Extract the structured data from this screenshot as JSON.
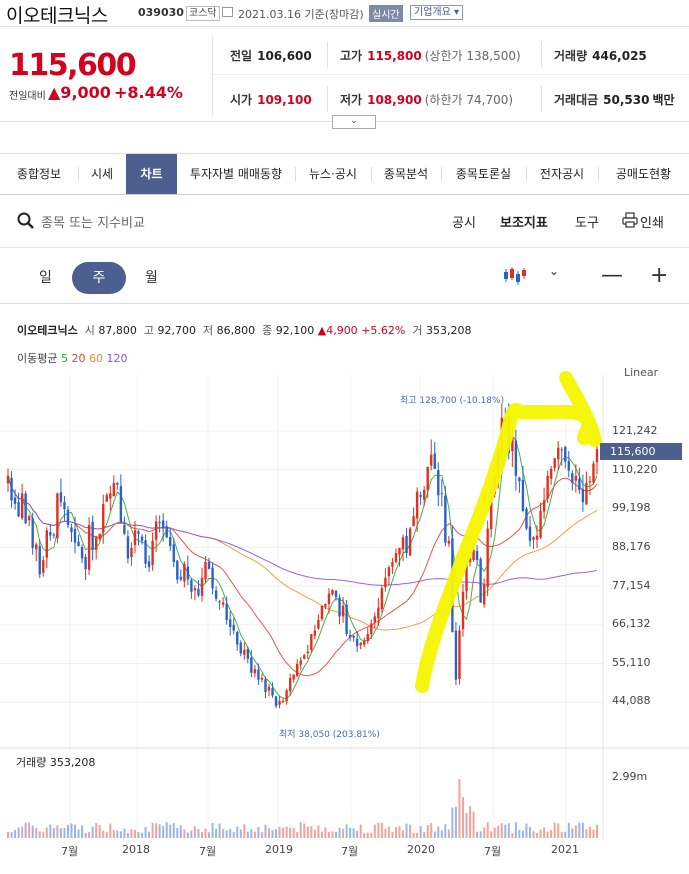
{
  "header": {
    "name": "이오테크닉스",
    "code": "039030",
    "market": "코스닥",
    "date_label": "2021.03.16 기준(장마감)",
    "realtime": "실시간",
    "overview": "기업개요 ▾"
  },
  "price": {
    "current": "115,600",
    "change_label": "전일대비",
    "change": "▲9,000",
    "change_pct": "+8.44%"
  },
  "stats": {
    "prev_label": "전일",
    "prev": "106,600",
    "high_label": "고가",
    "high": "115,800",
    "high_sub": "(상한가 138,500)",
    "volume_label": "거래량",
    "volume": "446,025",
    "open_label": "시가",
    "open": "109,100",
    "low_label": "저가",
    "low": "108,900",
    "low_sub": "(하한가 74,700)",
    "amount_label": "거래대금",
    "amount": "50,530",
    "amount_unit": "백만"
  },
  "tabs": [
    "종합정보",
    "시세",
    "차트",
    "투자자별 매매동향",
    "뉴스·공시",
    "종목분석",
    "종목토론실",
    "전자공시",
    "공매도현황"
  ],
  "search": {
    "placeholder": "종목 또는 지수비교",
    "tools": [
      "공시",
      "보조지표",
      "도구",
      "인쇄"
    ]
  },
  "periods": [
    "일",
    "주",
    "월"
  ],
  "legend": {
    "name": "이오테크닉스",
    "o_label": "시",
    "o": "87,800",
    "h_label": "고",
    "h": "92,700",
    "l_label": "저",
    "l": "86,800",
    "c_label": "종",
    "c": "92,100",
    "chg": "▲4,900",
    "pct": "+5.62%",
    "v_label": "거",
    "v": "353,208",
    "ma_label": "이동평균",
    "ma": [
      "5",
      "20",
      "60",
      "120"
    ]
  },
  "colors": {
    "up": "#e0301e",
    "down": "#2a63c8",
    "accent": "#4d5f8e",
    "ma5": "#3aa636",
    "ma20": "#e8433a",
    "ma60": "#ef9535",
    "ma120": "#8c55cc"
  },
  "chart_data": {
    "type": "line",
    "title": "",
    "scale": "Linear",
    "y_ticks": [
      "121,242",
      "110,220",
      "99,198",
      "88,176",
      "77,154",
      "66,132",
      "55,110",
      "44,088"
    ],
    "current_price_label": "115,600",
    "high_annotation": "최고 128,700 (-10.18%)",
    "low_annotation": "최저 38,050 (203.81%)",
    "x_ticks": [
      "7월",
      "2018",
      "7월",
      "2019",
      "7월",
      "2020",
      "7월",
      "2021"
    ],
    "volume_label": "거래량 353,208",
    "volume_tick": "2.99m",
    "series": [
      {
        "name": "종가",
        "values": [
          108000,
          101000,
          100000,
          96500,
          103000,
          94500,
          96500,
          87500,
          88500,
          80000,
          84000,
          92500,
          91000,
          91000,
          103000,
          100500,
          98500,
          94000,
          92000,
          89000,
          88000,
          84500,
          81500,
          94000,
          87000,
          90500,
          91500,
          100000,
          102500,
          103000,
          106000,
          105500,
          95000,
          91500,
          84500,
          87500,
          92500,
          91500,
          89500,
          83000,
          82000,
          89500,
          95000,
          94500,
          93000,
          90500,
          88000,
          83500,
          78500,
          78500,
          83000,
          78500,
          75000,
          76000,
          74000,
          79000,
          83500,
          81500,
          76000,
          73000,
          72000,
          72000,
          67000,
          65000,
          64000,
          60000,
          57500,
          58500,
          56000,
          52000,
          53000,
          50000,
          50500,
          46500,
          48000,
          45500,
          42500,
          44000,
          44000,
          47000,
          50500,
          51500,
          54500,
          55500,
          57000,
          58000,
          63000,
          64000,
          67000,
          71000,
          71500,
          74500,
          75500,
          73500,
          68000,
          71000,
          63000,
          62000,
          62000,
          59500,
          60500,
          61000,
          63000,
          66000,
          68000,
          70500,
          76000,
          79000,
          82000,
          83500,
          86000,
          87500,
          90500,
          86000,
          93000,
          96500,
          103500,
          102000,
          104000,
          110500,
          114000,
          110000,
          102500,
          103000,
          89000,
          89500,
          63500,
          50000,
          64000,
          75000,
          83500,
          84500,
          87000,
          84000,
          72000,
          77000,
          93000,
          102000,
          108000,
          115000,
          124500,
          124000,
          114500,
          119000,
          108000,
          106500,
          98000,
          93000,
          89500,
          90500,
          91000,
          98000,
          101000,
          108000,
          110000,
          113000,
          116000,
          115500,
          112000,
          109500,
          106000,
          108000,
          104000,
          100500,
          106000,
          106500,
          111500,
          115600
        ]
      },
      {
        "name": "MA5",
        "values": []
      },
      {
        "name": "MA20",
        "values": []
      },
      {
        "name": "MA60",
        "values": []
      },
      {
        "name": "MA120",
        "values": []
      }
    ]
  }
}
